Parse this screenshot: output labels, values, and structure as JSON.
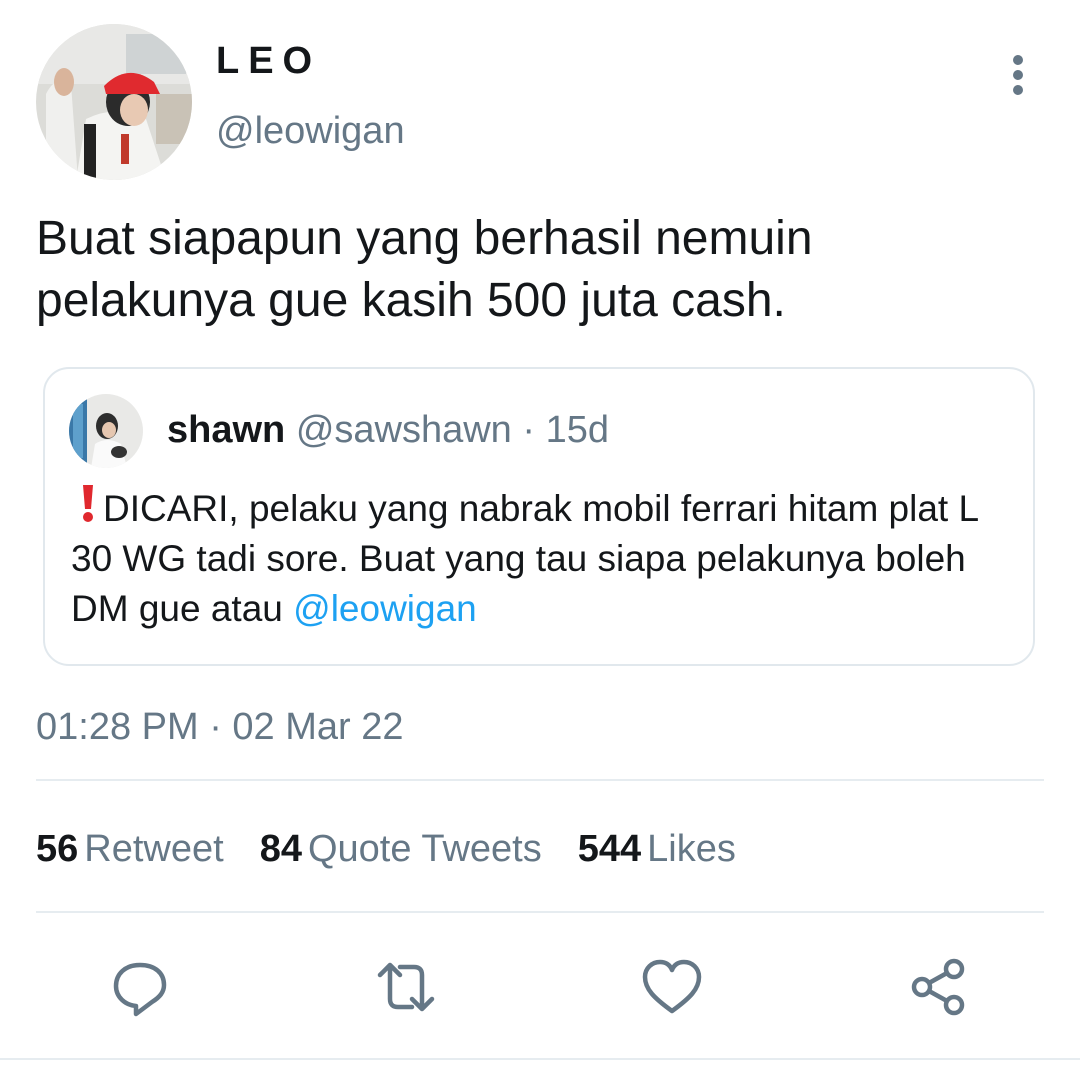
{
  "author": {
    "display_name": "LEO",
    "handle": "@leowigan"
  },
  "tweet": {
    "text": "Buat siapapun yang berhasil nemuin pelakunya gue kasih 500 juta cash.",
    "timestamp": "01:28 PM · 02 Mar 22"
  },
  "quoted_tweet": {
    "display_name": "shawn",
    "meta": "@sawshawn · 15d",
    "emoji": "❗",
    "text": "DICARI, pelaku yang nabrak mobil ferrari hitam plat L 30 WG tadi sore. Buat yang tau siapa pelakunya boleh DM gue atau ",
    "mention": "@leowigan"
  },
  "stats": {
    "retweets_count": "56",
    "retweets_label": "Retweet",
    "quotes_count": "84",
    "quotes_label": "Quote Tweets",
    "likes_count": "544",
    "likes_label": "Likes"
  },
  "icons": {
    "more": "more-vertical-icon",
    "reply": "reply-icon",
    "retweet": "retweet-icon",
    "like": "heart-icon",
    "share": "share-icon"
  },
  "colors": {
    "text": "#14171a",
    "secondary": "#657786",
    "link": "#1da1f2",
    "border": "#e1e8ed"
  }
}
